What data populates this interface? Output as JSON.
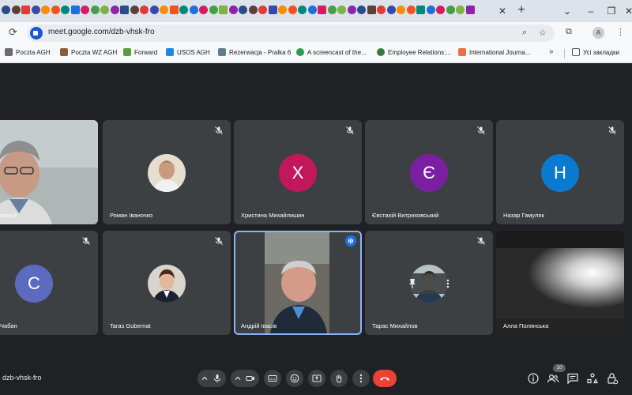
{
  "browser": {
    "url": "meet.google.com/dzb-vhsk-fro",
    "profile_initial": "A",
    "tab_close": "✕",
    "new_tab": "+",
    "bookmarks": [
      {
        "label": "Poczta AGH",
        "color": "#6b6b6b"
      },
      {
        "label": "Poczta WZ AGH",
        "color": "#8e5c3b"
      },
      {
        "label": "Forward",
        "color": "#5a9e3a"
      },
      {
        "label": "USOS AGH",
        "color": "#1e88e5"
      },
      {
        "label": "Rezerwacja - Pralka 6",
        "color": "#607d8b"
      },
      {
        "label": "A screencast of the...",
        "color": "#2e9d4e"
      },
      {
        "label": "Employee Relations:...",
        "color": "#3a7a3a"
      },
      {
        "label": "International Journa...",
        "color": "#e57343"
      }
    ],
    "bookmarks_folder": "Усі закладки"
  },
  "meet": {
    "meeting_code": "dzb-vhsk-fro",
    "participant_count": "10",
    "participants": [
      {
        "name": "rasyuk",
        "type": "video"
      },
      {
        "name": "Роман Іваночко",
        "type": "photo"
      },
      {
        "name": "Христина Михайлишин",
        "type": "letter",
        "letter": "Х",
        "color": "#c2185b"
      },
      {
        "name": "Євстахій Витриховський",
        "type": "letter",
        "letter": "Є",
        "color": "#7b1fa2"
      },
      {
        "name": "Назар Гамуляк",
        "type": "letter",
        "letter": "Н",
        "color": "#0b7ad1"
      },
      {
        "name": "Чабан",
        "type": "letter",
        "letter": "С",
        "color": "#5c6bc0"
      },
      {
        "name": "Taras Gubernat",
        "type": "photo"
      },
      {
        "name": "Андрій Івасів",
        "type": "video",
        "speaking": true
      },
      {
        "name": "Тарас Михайлов",
        "type": "photo"
      },
      {
        "name": "Алла Полянська",
        "type": "video"
      }
    ]
  }
}
